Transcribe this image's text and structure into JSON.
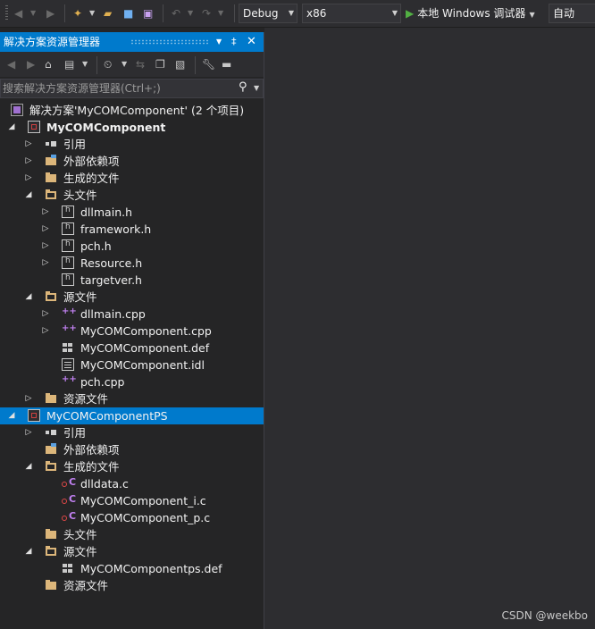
{
  "toolbar": {
    "config": "Debug",
    "platform": "x86",
    "debugger": "本地 Windows 调试器",
    "auto": "自动"
  },
  "solution_explorer": {
    "title": "解决方案资源管理器",
    "search": {
      "placeholder": "搜索解决方案资源管理器(Ctrl+;)"
    },
    "tree": [
      {
        "label": "解决方案'MyCOMComponent' (2 个项目)",
        "icon": "solution-icon",
        "expander": ""
      },
      {
        "label": "MyCOMComponent",
        "icon": "project-icon",
        "expander": "expanded",
        "bold": true
      },
      {
        "label": "引用",
        "icon": "references-icon",
        "expander": "collapsed"
      },
      {
        "label": "外部依赖项",
        "icon": "external-deps-icon",
        "expander": "collapsed"
      },
      {
        "label": "生成的文件",
        "icon": "folder-icon",
        "expander": "collapsed"
      },
      {
        "label": "头文件",
        "icon": "folder-open-icon",
        "expander": "expanded"
      },
      {
        "label": "dllmain.h",
        "icon": "header-file-icon",
        "expander": "collapsed"
      },
      {
        "label": "framework.h",
        "icon": "header-file-icon",
        "expander": "collapsed"
      },
      {
        "label": "pch.h",
        "icon": "header-file-icon",
        "expander": "collapsed"
      },
      {
        "label": "Resource.h",
        "icon": "header-file-icon",
        "expander": "collapsed"
      },
      {
        "label": "targetver.h",
        "icon": "header-file-icon",
        "expander": ""
      },
      {
        "label": "源文件",
        "icon": "folder-open-icon",
        "expander": "expanded"
      },
      {
        "label": "dllmain.cpp",
        "icon": "cpp-file-icon",
        "expander": "collapsed"
      },
      {
        "label": "MyCOMComponent.cpp",
        "icon": "cpp-file-icon",
        "expander": "collapsed"
      },
      {
        "label": "MyCOMComponent.def",
        "icon": "def-file-icon",
        "expander": ""
      },
      {
        "label": "MyCOMComponent.idl",
        "icon": "idl-file-icon",
        "expander": ""
      },
      {
        "label": "pch.cpp",
        "icon": "cpp-file-icon",
        "expander": ""
      },
      {
        "label": "资源文件",
        "icon": "folder-icon",
        "expander": "collapsed"
      },
      {
        "label": "MyCOMComponentPS",
        "icon": "project-icon",
        "expander": "expanded",
        "selected": true
      },
      {
        "label": "引用",
        "icon": "references-icon",
        "expander": "collapsed"
      },
      {
        "label": "外部依赖项",
        "icon": "external-deps-icon",
        "expander": ""
      },
      {
        "label": "生成的文件",
        "icon": "folder-open-icon",
        "expander": "expanded"
      },
      {
        "label": "dlldata.c",
        "icon": "c-file-icon",
        "expander": ""
      },
      {
        "label": "MyCOMComponent_i.c",
        "icon": "c-file-icon",
        "expander": ""
      },
      {
        "label": "MyCOMComponent_p.c",
        "icon": "c-file-icon",
        "expander": ""
      },
      {
        "label": "头文件",
        "icon": "folder-icon",
        "expander": ""
      },
      {
        "label": "源文件",
        "icon": "folder-open-icon",
        "expander": "expanded"
      },
      {
        "label": "MyCOMComponentps.def",
        "icon": "def-file-icon",
        "expander": ""
      },
      {
        "label": "资源文件",
        "icon": "folder-icon",
        "expander": ""
      }
    ]
  },
  "watermark": "CSDN @weekbo"
}
